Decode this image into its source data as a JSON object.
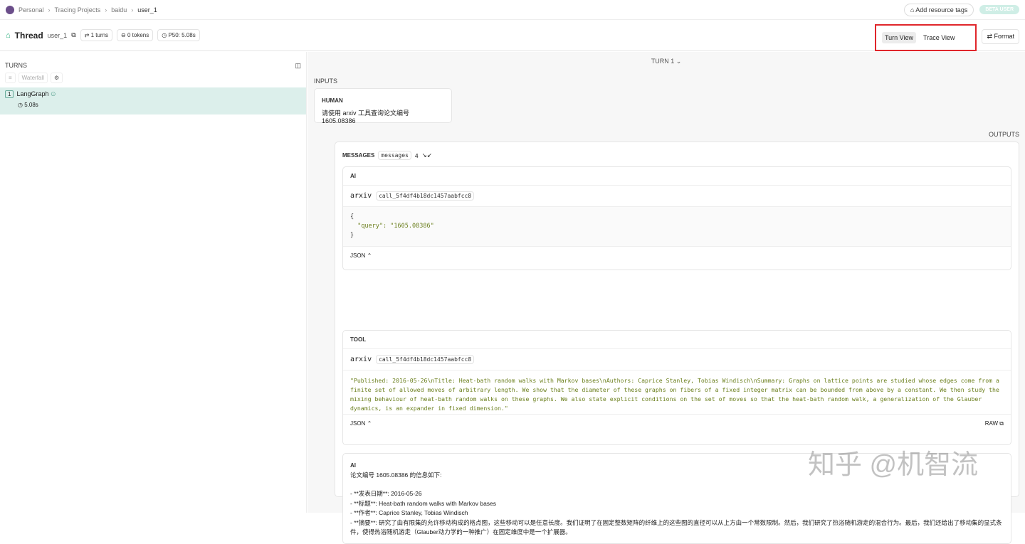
{
  "breadcrumb": [
    "Personal",
    "Tracing Projects",
    "baidu",
    "user_1"
  ],
  "top_actions": {
    "add_tags": "Add resource tags",
    "beta": "BETA USER"
  },
  "header": {
    "title": "Thread",
    "thread_id": "user_1",
    "turns": "1 turns",
    "tokens": "0 tokens",
    "p50": "P50: 5.08s",
    "turn_view": "Turn View",
    "trace_view": "Trace View",
    "format": "Format"
  },
  "sidebar": {
    "title": "TURNS",
    "waterfall": "Waterfall",
    "items": [
      {
        "num": "1",
        "name": "LangGraph",
        "time": "5.08s"
      }
    ]
  },
  "main": {
    "turn": "TURN 1",
    "inputs": "INPUTS",
    "human_label": "HUMAN",
    "human_text": "请使用 arxiv 工具查询论文编号 1605.08386",
    "outputs": "OUTPUTS",
    "messages_label": "MESSAGES",
    "messages_key": "messages",
    "messages_count": "4",
    "ai1": {
      "role": "AI",
      "tool": "arxiv",
      "call_id": "call_5f4df4b18dc1457aabfcc8",
      "code": [
        "{",
        "  \"query\": \"1605.08386\"",
        "}"
      ],
      "format": "JSON"
    },
    "tool": {
      "role": "TOOL",
      "tool": "arxiv",
      "call_id": "call_5f4df4b18dc1457aabfcc8",
      "content": "\"Published: 2016-05-26\\nTitle: Heat-bath random walks with Markov bases\\nAuthors: Caprice Stanley, Tobias Windisch\\nSummary: Graphs on lattice points are studied whose edges come from a finite set of allowed moves of arbitrary length. We show that the diameter of these graphs on fibers of a fixed integer matrix can be bounded from above by a constant. We then study the mixing behaviour of heat-bath random walks on these graphs. We also state explicit conditions on the set of moves so that the heat-bath random walk, a generalization of the Glauber dynamics, is an expander in fixed dimension.\"",
      "format": "JSON",
      "raw": "RAW"
    },
    "ai2": {
      "role": "AI",
      "lines": [
        "论文编号 1605.08386 的信息如下:",
        "",
        "- **发表日期**: 2016-05-26",
        "- **标题**: Heat-bath random walks with Markov bases",
        "- **作者**: Caprice Stanley, Tobias Windisch",
        "- **摘要**: 研究了由有限集的允许移动构成的格点图，这些移动可以是任意长度。我们证明了在固定整数矩阵的纤维上的这些图的直径可以从上方由一个常数限制。然后，我们研究了热浴随机游走的混合行为。最后，我们还给出了移动集的显式条件，使得热浴随机游走（Glauber动力学的一种推广）在固定维度中是一个扩展器。"
      ]
    }
  },
  "watermark": "知乎 @机智流"
}
